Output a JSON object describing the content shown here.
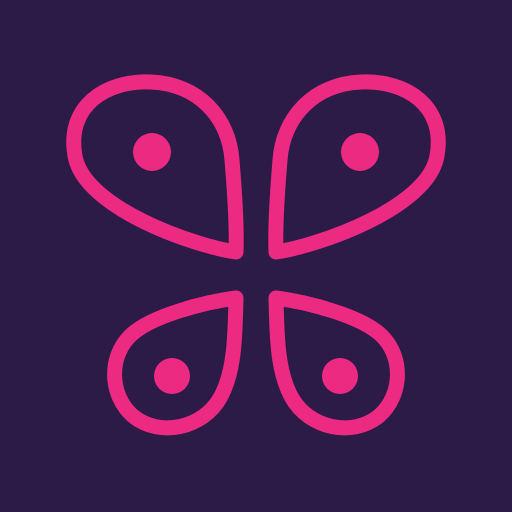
{
  "icon": {
    "name": "butterfly-logo-icon",
    "colors": {
      "background": "#2c1a47",
      "accent": "#ec2a82"
    }
  }
}
